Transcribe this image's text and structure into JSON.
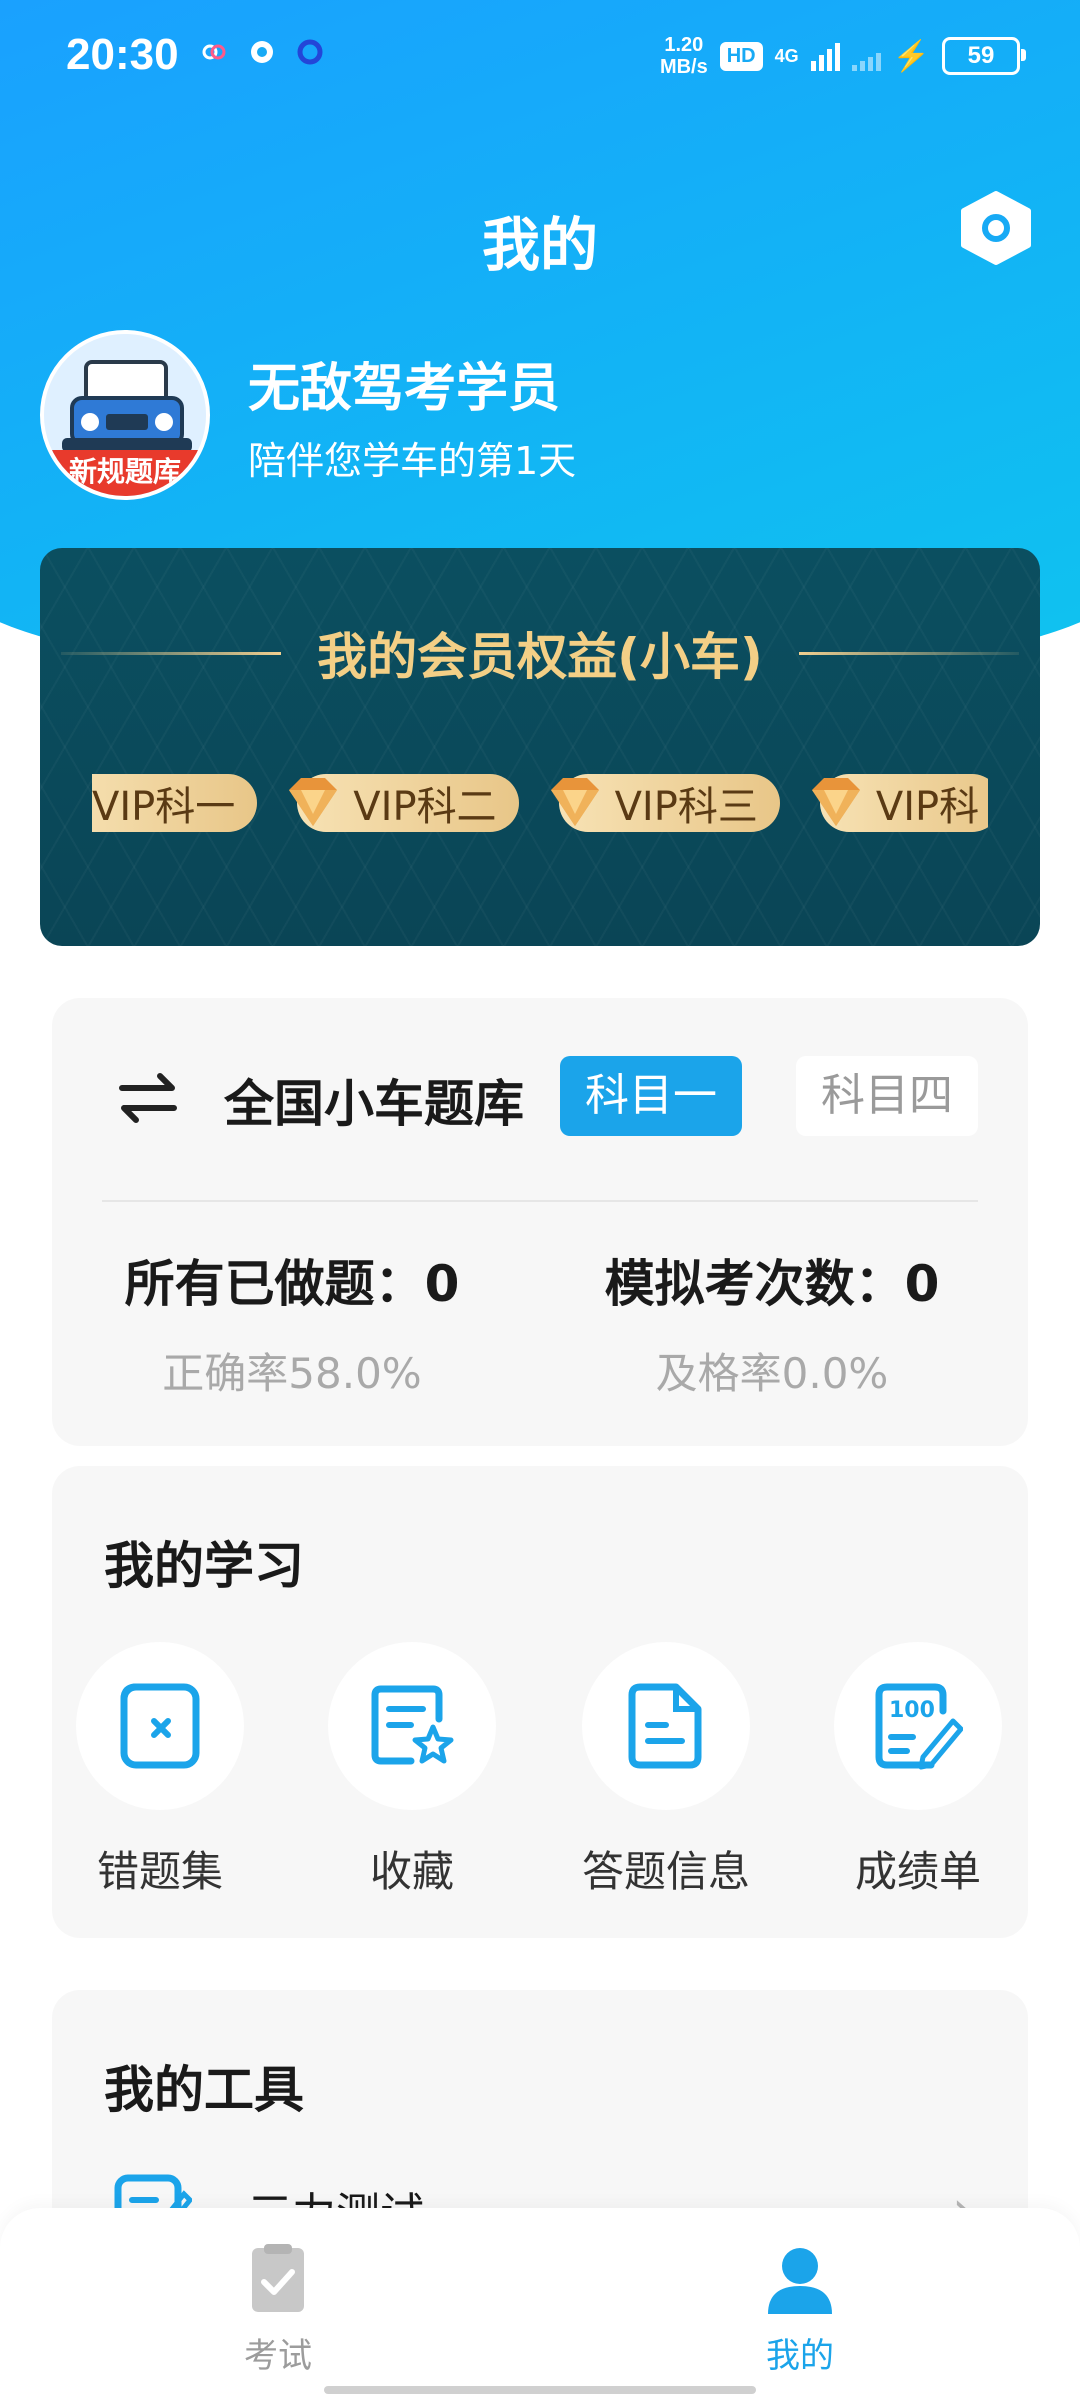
{
  "status_bar": {
    "time": "20:30",
    "net_speed_value": "1.20",
    "net_speed_unit": "MB/s",
    "hd_label": "HD",
    "hd_sub": "1",
    "network_type": "4G",
    "battery_level": "59"
  },
  "header": {
    "title": "我的",
    "settings_icon": "hexagon-settings-icon"
  },
  "profile": {
    "avatar_banner": "新规题库",
    "name": "无敌驾考学员",
    "subtitle": "陪伴您学车的第1天"
  },
  "vip": {
    "title": "我的会员权益(小车)",
    "chips": [
      "VIP科一",
      "VIP科二",
      "VIP科三",
      "VIP科"
    ]
  },
  "question_bank": {
    "title": "全国小车题库",
    "subject_active": "科目一",
    "subject_inactive": "科目四",
    "done_label": "所有已做题：0",
    "accuracy_label": "正确率58.0%",
    "mock_label": "模拟考次数：0",
    "pass_rate_label": "及格率0.0%"
  },
  "study": {
    "title": "我的学习",
    "items": [
      {
        "label": "错题集",
        "icon": "wrong-questions-icon"
      },
      {
        "label": "收藏",
        "icon": "favorites-icon"
      },
      {
        "label": "答题信息",
        "icon": "answer-info-icon"
      },
      {
        "label": "成绩单",
        "icon": "score-report-icon"
      }
    ]
  },
  "tools": {
    "title": "我的工具",
    "items": [
      {
        "label": "三力测试",
        "icon": "test-edit-icon"
      }
    ]
  },
  "bottom_nav": {
    "items": [
      {
        "label": "考试",
        "icon": "exam-icon",
        "active": false
      },
      {
        "label": "我的",
        "icon": "profile-icon",
        "active": true
      }
    ]
  },
  "colors": {
    "header_gradient_start": "#1aa0ff",
    "header_gradient_end": "#0fc4ef",
    "accent_blue": "#1ba4ea",
    "vip_background": "#0b4f60",
    "vip_gold": "#f3cf86"
  }
}
